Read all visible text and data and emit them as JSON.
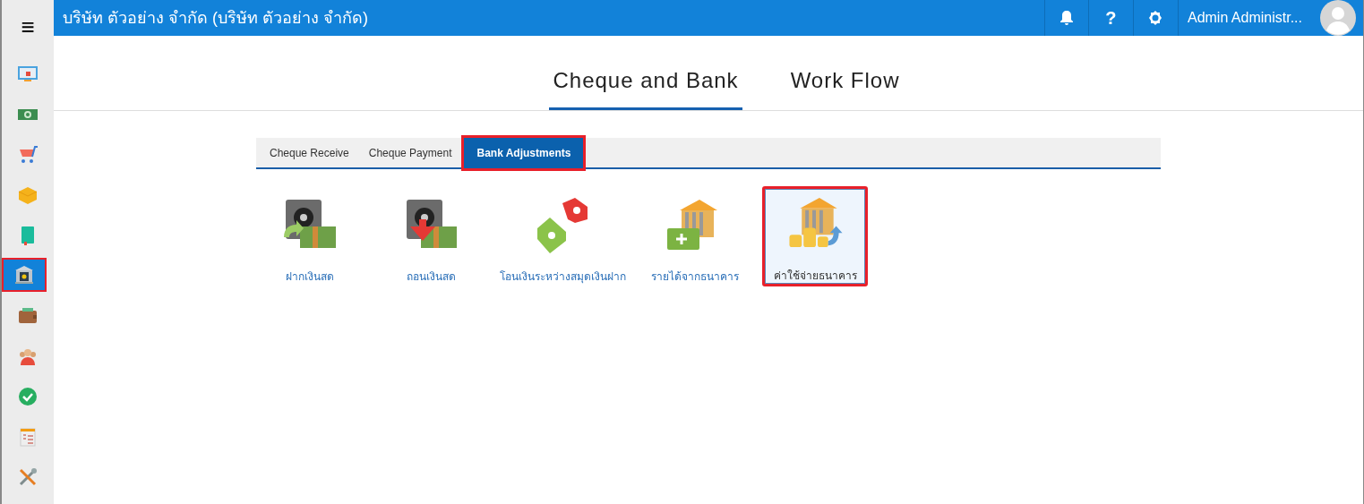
{
  "menu_button": {
    "label": "≡"
  },
  "topbar": {
    "title": "บริษัท ตัวอย่าง จำกัด (บริษัท ตัวอย่าง จำกัด)",
    "help": "?",
    "user_name": "Admin Administr..."
  },
  "sidebar": {
    "items": [
      {
        "selected": false
      },
      {
        "selected": false
      },
      {
        "selected": false
      },
      {
        "selected": false
      },
      {
        "selected": false
      },
      {
        "selected": true
      },
      {
        "selected": false
      },
      {
        "selected": false
      },
      {
        "selected": false
      },
      {
        "selected": false
      },
      {
        "selected": false
      }
    ]
  },
  "main_tabs": [
    {
      "label": "Cheque and Bank",
      "selected": true
    },
    {
      "label": "Work Flow",
      "selected": false
    }
  ],
  "sub_tabs": [
    {
      "label": "Cheque Receive",
      "selected": false
    },
    {
      "label": "Cheque Payment",
      "selected": false
    },
    {
      "label": "Bank Adjustments",
      "selected": true
    }
  ],
  "tiles": [
    {
      "label": "ฝากเงินสด",
      "selected": false
    },
    {
      "label": "ถอนเงินสด",
      "selected": false
    },
    {
      "label": "โอนเงินระหว่างสมุดเงินฝาก",
      "selected": false
    },
    {
      "label": "รายได้จากธนาคาร",
      "selected": false
    },
    {
      "label": "ค่าใช้จ่ายธนาคาร",
      "selected": true
    }
  ]
}
